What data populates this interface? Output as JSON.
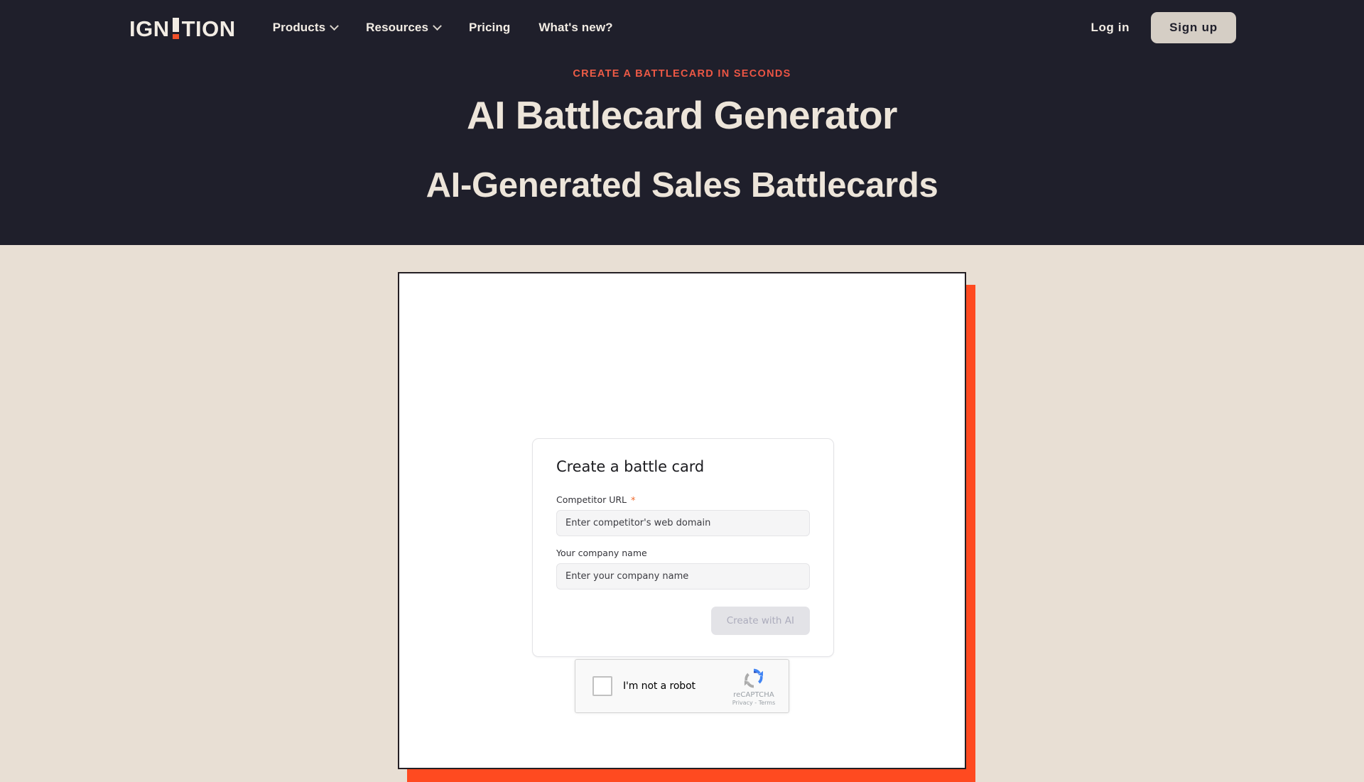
{
  "theme": {
    "hero_bg": "#1F1F2B",
    "page_bg": "#E8DFD4",
    "cream": "#EDE5DA",
    "accent_orange": "#F0502A",
    "accent_red": "#E63A3C",
    "panel_shadow": "#FF4A20"
  },
  "nav": {
    "logo": {
      "part_one": "IGN",
      "part_two": "TION",
      "icon": "exclamation-mark-logo"
    },
    "links": [
      {
        "label": "Products",
        "has_dropdown": true,
        "icon": "chevron-down-icon"
      },
      {
        "label": "Resources",
        "has_dropdown": true,
        "icon": "chevron-down-icon"
      },
      {
        "label": "Pricing",
        "has_dropdown": false
      },
      {
        "label": "What's new?",
        "has_dropdown": false
      }
    ],
    "login_label": "Log in",
    "signup_label": "Sign up"
  },
  "hero": {
    "eyebrow": "CREATE A BATTLECARD IN SECONDS",
    "heading": "AI Battlecard Generator",
    "subheading": "AI-Generated Sales Battlecards"
  },
  "form": {
    "title": "Create a battle card",
    "fields": [
      {
        "label": "Competitor URL",
        "required": true,
        "required_marker": "*",
        "value": "",
        "placeholder": "Enter competitor's web domain"
      },
      {
        "label": "Your company name",
        "required": false,
        "required_marker": "",
        "value": "",
        "placeholder": "Enter your company name"
      }
    ],
    "submit_label": "Create with AI",
    "submit_disabled": true
  },
  "recaptcha": {
    "checkbox_label": "I'm not a robot",
    "brand": "reCAPTCHA",
    "privacy": "Privacy",
    "separator": " - ",
    "terms": "Terms",
    "icon": "recaptcha-logo"
  }
}
